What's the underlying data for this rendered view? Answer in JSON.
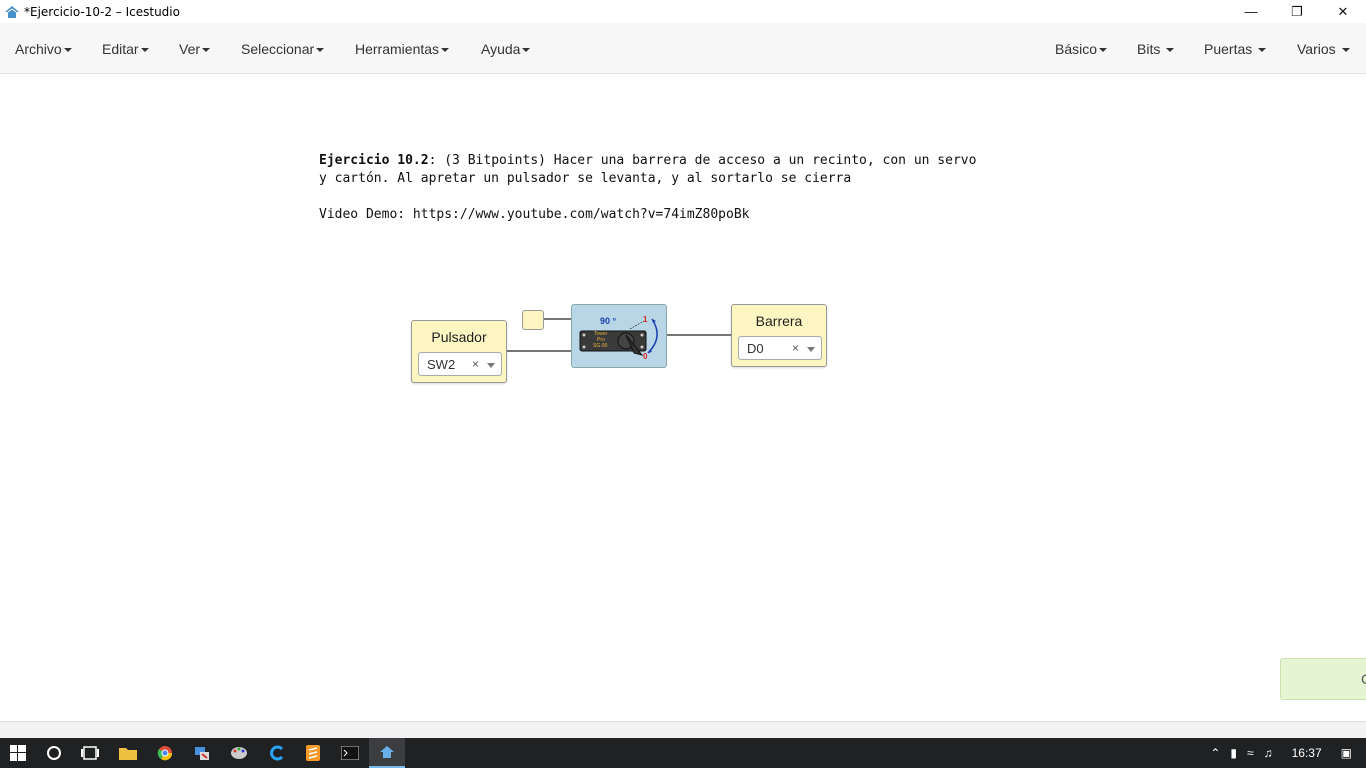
{
  "window": {
    "title": "*Ejercicio-10-2 – Icestudio",
    "minimize": "—",
    "restore": "❐",
    "close": "✕"
  },
  "menu_left": [
    {
      "label": "Archivo"
    },
    {
      "label": "Editar"
    },
    {
      "label": "Ver"
    },
    {
      "label": "Seleccionar"
    },
    {
      "label": "Herramientas"
    },
    {
      "label": "Ayuda"
    }
  ],
  "menu_right": [
    {
      "label": "Básico"
    },
    {
      "label": "Bits"
    },
    {
      "label": "Puertas"
    },
    {
      "label": "Varios"
    }
  ],
  "note": {
    "bold": "Ejercicio 10.2",
    "line1_rest": ": (3 Bitpoints) Hacer una barrera de acceso a un recinto, con un servo",
    "line2": "y cartón. Al apretar un pulsador se levanta, y al sortarlo se cierra",
    "line4": "Video Demo: https://www.youtube.com/watch?v=74imZ80poBk"
  },
  "blocks": {
    "input": {
      "label": "Pulsador",
      "value": "SW2",
      "clear": "×"
    },
    "output": {
      "label": "Barrera",
      "value": "D0",
      "clear": "×"
    },
    "servo": {
      "angle": "90 °",
      "top_mark": "1",
      "bottom_mark": "0",
      "brand_line1": "Tower",
      "brand_line2": "Pro",
      "brand_line3": "SG-90"
    }
  },
  "toast": {
    "text": "C"
  },
  "taskbar": {
    "time": "16:37"
  },
  "colors": {
    "block_fill": "#fdf6c3",
    "servo_fill": "#b8d6e6",
    "taskbar": "#1f2123"
  }
}
